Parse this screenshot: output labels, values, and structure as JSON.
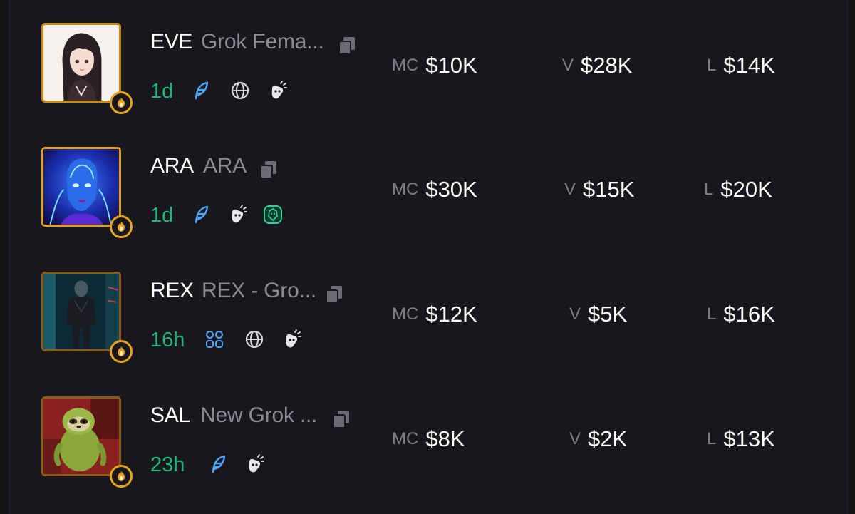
{
  "colors": {
    "background": "#18181c",
    "age_green": "#1fb47c",
    "avatar_border": "#c8891a",
    "muted_text": "#8a8a96",
    "twitter_blue": "#4da6ff"
  },
  "labels": {
    "mc": "MC",
    "v": "V",
    "l": "L"
  },
  "tokens": [
    {
      "ticker": "EVE",
      "name": "Grok Fema...",
      "age": "1d",
      "socials": [
        "feather-icon",
        "globe-icon",
        "pump-icon"
      ],
      "mc": "$10K",
      "volume": "$28K",
      "liquidity": "$14K"
    },
    {
      "ticker": "ARA",
      "name": "ARA",
      "age": "1d",
      "socials": [
        "feather-icon",
        "pump-icon",
        "lion-shield-icon"
      ],
      "mc": "$30K",
      "volume": "$15K",
      "liquidity": "$20K"
    },
    {
      "ticker": "REX",
      "name": "REX - Gro...",
      "age": "16h",
      "socials": [
        "community-icon",
        "globe-icon",
        "pump-icon"
      ],
      "mc": "$12K",
      "volume": "$5K",
      "liquidity": "$16K"
    },
    {
      "ticker": "SAL",
      "name": "New Grok ...",
      "age": "23h",
      "socials": [
        "feather-icon",
        "pump-icon"
      ],
      "mc": "$8K",
      "volume": "$2K",
      "liquidity": "$13K"
    }
  ]
}
